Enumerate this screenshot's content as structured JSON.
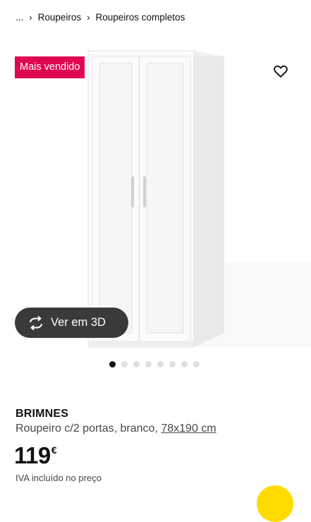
{
  "breadcrumb": {
    "ellipsis": "...",
    "items": [
      "Roupeiros",
      "Roupeiros completos"
    ]
  },
  "gallery": {
    "badge": "Mais vendido",
    "view3d_label": "Ver em 3D",
    "dots_total": 8,
    "active_dot": 0
  },
  "product": {
    "name": "BRIMNES",
    "description": "Roupeiro c/2 portas, branco,",
    "dimensions": "78x190 cm",
    "price": "119",
    "currency": "€",
    "vat_note": "IVA incluído no preço"
  },
  "colors": {
    "badge": "#e00751",
    "view3d_bg": "#3a3a3a",
    "accent_yellow": "#ffdb00",
    "dot_active": "#111111",
    "dot_inactive": "#dfdfdf"
  },
  "icons": {
    "separator": "chevron-right-icon",
    "favourite": "heart-icon",
    "view3d": "rotate-3d-icon"
  }
}
